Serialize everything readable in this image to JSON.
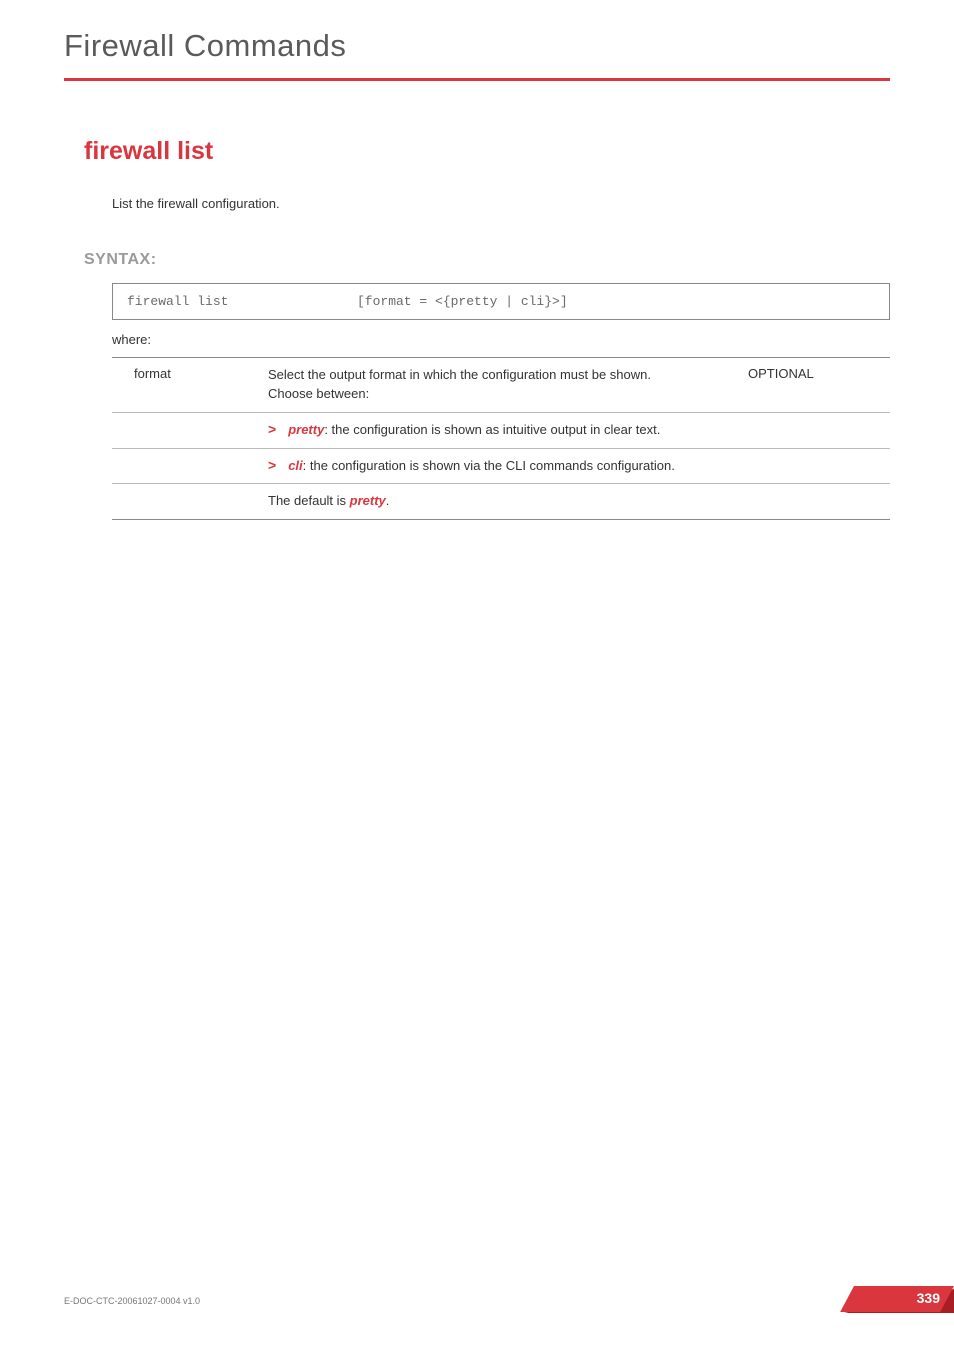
{
  "header": {
    "title": "Firewall Commands"
  },
  "section": {
    "title": "firewall list",
    "description": "List the firewall configuration."
  },
  "syntax": {
    "label": "SYNTAX:",
    "command": "firewall list",
    "args": "[format = <{pretty | cli}>]"
  },
  "where_label": "where:",
  "param": {
    "name": "format",
    "desc_intro": "Select the output format in which the configuration must be shown.\nChoose between:",
    "optional": "OPTIONAL",
    "bullets": [
      {
        "term": "pretty",
        "rest": ": the configuration is shown as intuitive output in clear text."
      },
      {
        "term": "cli",
        "rest": ": the configuration is shown via the CLI commands configuration."
      }
    ],
    "default_prefix": "The default is ",
    "default_value": "pretty",
    "default_suffix": "."
  },
  "footer": {
    "doc_id": "E-DOC-CTC-20061027-0004 v1.0",
    "page_number": "339"
  }
}
